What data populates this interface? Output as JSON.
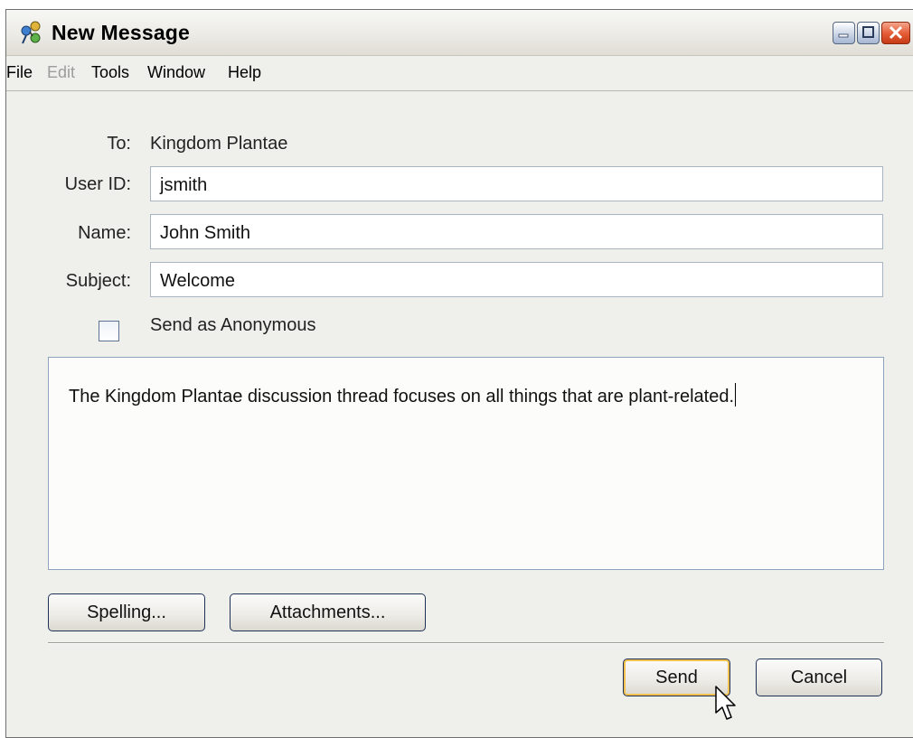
{
  "window": {
    "title": "New Message",
    "app_icon": "people-network-icon",
    "controls": [
      "minimize-icon",
      "maximize-icon",
      "close-icon"
    ]
  },
  "menu": {
    "items": [
      {
        "label": "File",
        "enabled": true
      },
      {
        "label": "Edit",
        "enabled": false
      },
      {
        "label": "Tools",
        "enabled": true
      },
      {
        "label": "Window",
        "enabled": true
      },
      {
        "label": "Help",
        "enabled": true
      }
    ]
  },
  "form": {
    "to_label": "To:",
    "to_value": "Kingdom Plantae",
    "userid_label": "User ID:",
    "userid_value": "jsmith",
    "name_label": "Name:",
    "name_value": "John Smith",
    "subject_label": "Subject:",
    "subject_value": "Welcome",
    "anonymous_label": "Send as Anonymous",
    "anonymous_checked": false
  },
  "message": {
    "body": "The Kingdom Plantae discussion thread focuses on all things that are plant-related."
  },
  "buttons": {
    "spelling": "Spelling...",
    "attachments": "Attachments...",
    "send": "Send",
    "cancel": "Cancel"
  },
  "colors": {
    "focus_ring": "#f2c04e",
    "close_button": "#e45a33"
  }
}
